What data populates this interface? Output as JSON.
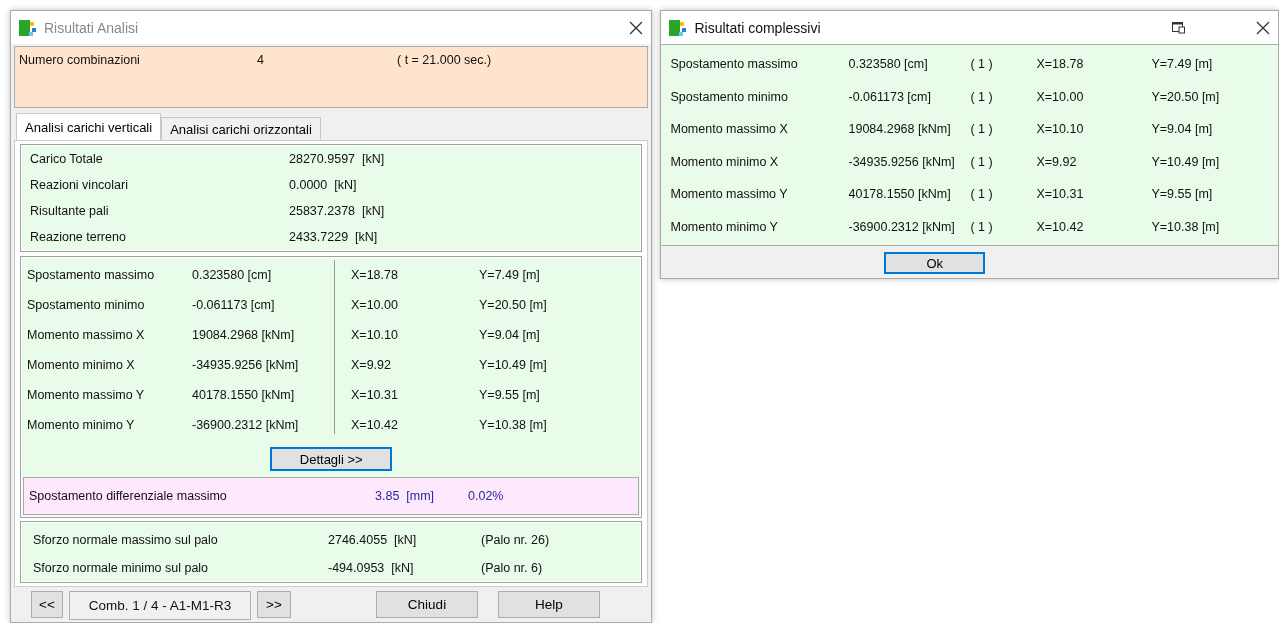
{
  "analysis_window": {
    "title": "Risultati Analisi",
    "header": {
      "label": "Numero combinazioni",
      "value": "4",
      "time": "( t = 21.000 sec.)"
    },
    "tabs": [
      {
        "label": "Analisi carichi verticali",
        "selected": true
      },
      {
        "label": "Analisi carichi orizzontali",
        "selected": false
      }
    ],
    "totals": [
      {
        "label": "Carico Totale",
        "value": "28270.9597  [kN]"
      },
      {
        "label": "Reazioni vincolari",
        "value": "0.0000  [kN]"
      },
      {
        "label": "Risultante pali",
        "value": "25837.2378  [kN]"
      },
      {
        "label": "Reazione terreno",
        "value": "2433.7229  [kN]"
      }
    ],
    "extremes": [
      {
        "label": "Spostamento massimo",
        "value": "0.323580  [cm]",
        "x": "X=18.78",
        "y": "Y=7.49  [m]"
      },
      {
        "label": "Spostamento minimo",
        "value": "-0.061173  [cm]",
        "x": "X=10.00",
        "y": "Y=20.50  [m]"
      },
      {
        "label": "Momento massimo X",
        "value": "19084.2968  [kNm]",
        "x": "X=10.10",
        "y": "Y=9.04  [m]"
      },
      {
        "label": "Momento minimo X",
        "value": "-34935.9256  [kNm]",
        "x": "X=9.92",
        "y": "Y=10.49  [m]"
      },
      {
        "label": "Momento massimo Y",
        "value": "40178.1550  [kNm]",
        "x": "X=10.31",
        "y": "Y=9.55  [m]"
      },
      {
        "label": "Momento minimo Y",
        "value": "-36900.2312  [kNm]",
        "x": "X=10.42",
        "y": "Y=10.38  [m]"
      }
    ],
    "details_button": "Dettagli >>",
    "differential": {
      "label": "Spostamento differenziale massimo",
      "value": "3.85  [mm]",
      "percent": "0.02%"
    },
    "pile_forces": [
      {
        "label": "Sforzo normale massimo sul palo",
        "value": "2746.4055  [kN]",
        "pile": "(Palo nr. 26)"
      },
      {
        "label": "Sforzo normale minimo sul palo",
        "value": "-494.0953  [kN]",
        "pile": "(Palo nr. 6)"
      }
    ],
    "navigation": {
      "previous": "<<",
      "combination": "Comb. 1 / 4 - A1-M1-R3",
      "next": ">>"
    },
    "buttons": [
      "Chiudi",
      "Help"
    ]
  },
  "summary_window": {
    "title": "Risultati complessivi",
    "rows": [
      {
        "label": "Spostamento massimo",
        "value": "0.323580  [cm]",
        "combination": "( 1 )",
        "x": "X=18.78",
        "y": "Y=7.49  [m]"
      },
      {
        "label": "Spostamento minimo",
        "value": "-0.061173  [cm]",
        "combination": "( 1 )",
        "x": "X=10.00",
        "y": "Y=20.50  [m]"
      },
      {
        "label": "Momento massimo X",
        "value": "19084.2968  [kNm]",
        "combination": "( 1 )",
        "x": "X=10.10",
        "y": "Y=9.04  [m]"
      },
      {
        "label": "Momento minimo X",
        "value": "-34935.9256  [kNm]",
        "combination": "( 1 )",
        "x": "X=9.92",
        "y": "Y=10.49  [m]"
      },
      {
        "label": "Momento massimo Y",
        "value": "40178.1550  [kNm]",
        "combination": "( 1 )",
        "x": "X=10.31",
        "y": "Y=9.55  [m]"
      },
      {
        "label": "Momento minimo Y",
        "value": "-36900.2312  [kNm]",
        "combination": "( 1 )",
        "x": "X=10.42",
        "y": "Y=10.38  [m]"
      }
    ],
    "ok_button": "Ok"
  }
}
